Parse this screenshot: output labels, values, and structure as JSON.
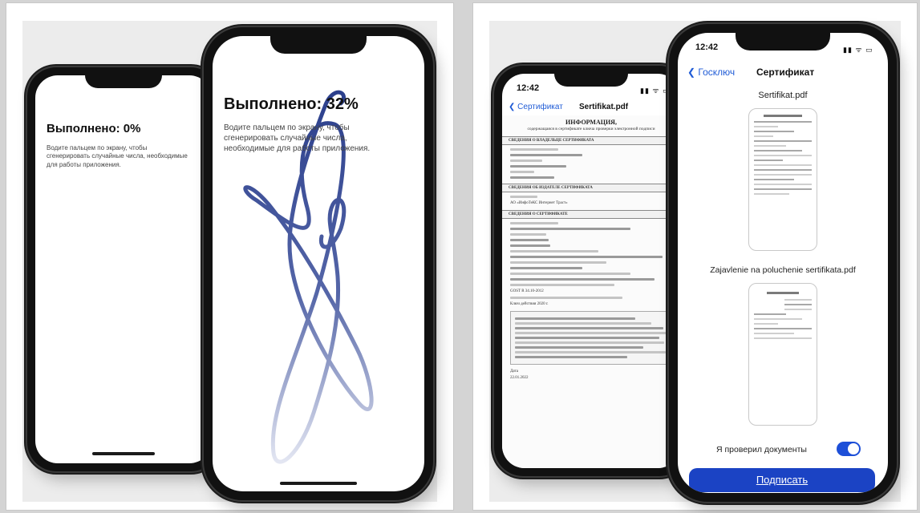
{
  "left_panel": {
    "phone_back": {
      "progress_title": "Выполнено: 0%",
      "instruction": "Водите пальцем по экрану, чтобы сгенерировать случайные числа, необходимые для работы приложения."
    },
    "phone_front": {
      "progress_title": "Выполнено: 32%",
      "instruction": "Водите пальцем по экрану, чтобы сгенерировать случайные числа, необходимые для работы приложения.",
      "progress_value": 0.32
    }
  },
  "right_panel": {
    "phone_back": {
      "status_time": "12:42",
      "status_icons": "▮▮ ᯤ ▭",
      "nav_back_label": "Сертификат",
      "nav_title": "Sertifikat.pdf",
      "doc_heading": "ИНФОРМАЦИЯ,",
      "doc_subheading": "содержащаяся в сертификате ключа проверки электронной подписи",
      "sections": [
        "СВЕДЕНИЯ О ВЛАДЕЛЬЦЕ СЕРТИФИКАТА",
        "СВЕДЕНИЯ ОБ ИЗДАТЕЛЕ СЕРТИФИКАТА",
        "СВЕДЕНИЯ О СЕРТИФИКАТЕ"
      ],
      "issuer_text": "АО «ИнфоТеКС Интернет Траст»",
      "algorithm_text": "GOST R 34.10-2012",
      "key_usage_text": "Ключ действия 2020 г.",
      "date_label": "Дата",
      "date_value": "22.01.2022"
    },
    "phone_front": {
      "status_time": "12:42",
      "status_icons": "▮▮ ᯤ ▭",
      "nav_back_label": "Госключ",
      "nav_title": "Сертификат",
      "files": [
        {
          "name": "Sertifikat.pdf"
        },
        {
          "name": "Zajavlenie na poluchenie sertifikata.pdf"
        }
      ],
      "checkbox_label": "Я проверил документы",
      "checkbox_checked": true,
      "sign_button": "Подписать"
    }
  },
  "colors": {
    "accent": "#1b43c4",
    "ios_link": "#1f5bd6",
    "scribble": "#2b3f8c"
  },
  "icons": {
    "back": "chevron-left-icon",
    "signal": "signal-icon",
    "wifi": "wifi-icon",
    "battery": "battery-icon"
  }
}
